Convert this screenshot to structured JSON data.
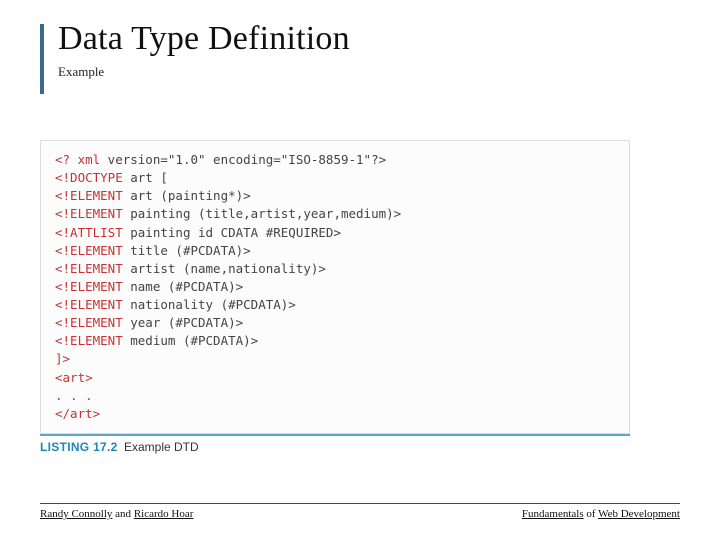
{
  "title": "Data Type Definition",
  "subtitle": "Example",
  "code": {
    "lines": [
      {
        "tag": "<? xml",
        "txt": " version=\"1.0\" encoding=\"ISO-8859-1\"?>"
      },
      {
        "tag": "<!DOCTYPE",
        "txt": " art ["
      },
      {
        "tag": "<!ELEMENT",
        "txt": " art (painting*)>"
      },
      {
        "tag": "<!ELEMENT",
        "txt": " painting (title,artist,year,medium)>"
      },
      {
        "tag": "<!ATTLIST",
        "txt": " painting id CDATA #REQUIRED>"
      },
      {
        "tag": "<!ELEMENT",
        "txt": " title (#PCDATA)>"
      },
      {
        "tag": "<!ELEMENT",
        "txt": " artist (name,nationality)>"
      },
      {
        "tag": "<!ELEMENT",
        "txt": " name (#PCDATA)>"
      },
      {
        "tag": "<!ELEMENT",
        "txt": " nationality (#PCDATA)>"
      },
      {
        "tag": "<!ELEMENT",
        "txt": " year (#PCDATA)>"
      },
      {
        "tag": "<!ELEMENT",
        "txt": " medium (#PCDATA)>"
      },
      {
        "tag": "]>",
        "txt": ""
      },
      {
        "tag": "<art>",
        "txt": ""
      },
      {
        "tag": ". . .",
        "txt": ""
      },
      {
        "tag": "</art>",
        "txt": ""
      }
    ]
  },
  "caption": {
    "label": "LISTING 17.2",
    "desc": "Example DTD"
  },
  "footer": {
    "left_u1": "Randy Connolly",
    "left_mid": " and ",
    "left_u2": "Ricardo Hoar",
    "right_u1": "Fundamentals",
    "right_mid": " of ",
    "right_u2": "Web Development"
  }
}
